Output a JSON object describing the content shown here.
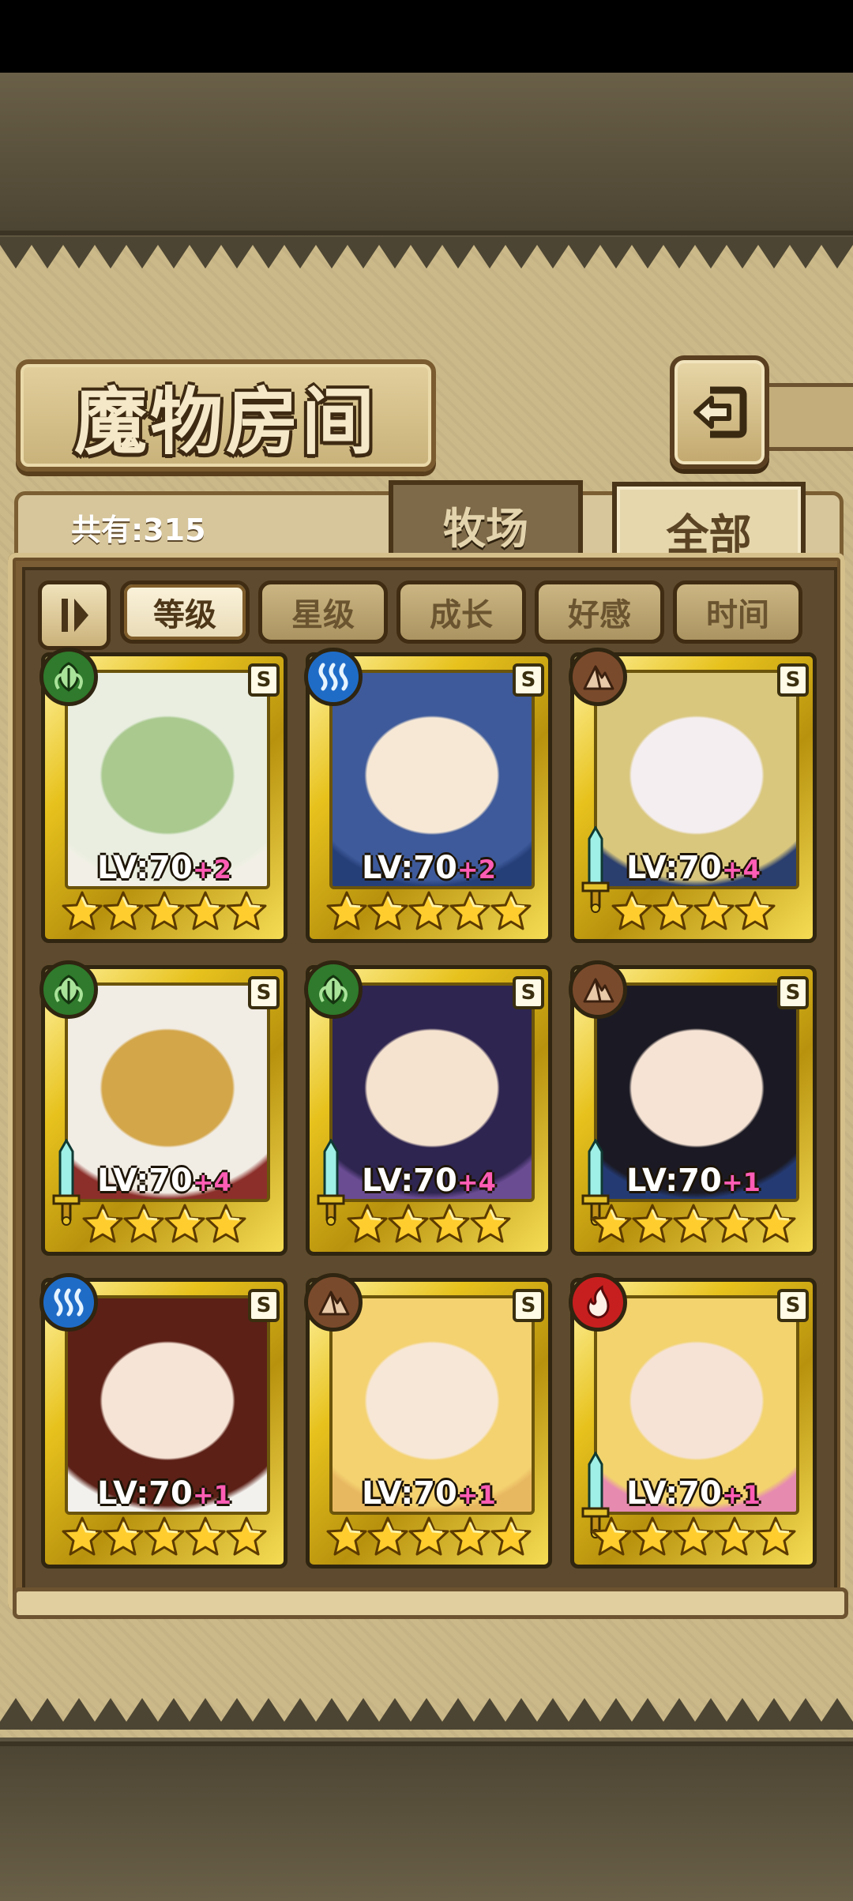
{
  "title": "魔物房间",
  "count_text": "共有:315",
  "tabs": [
    {
      "label": "牧场",
      "active": false
    },
    {
      "label": "全部",
      "active": true
    }
  ],
  "sort_filters": [
    {
      "label": "等级",
      "active": true
    },
    {
      "label": "星级",
      "active": false
    },
    {
      "label": "成长",
      "active": false
    },
    {
      "label": "好感",
      "active": false
    },
    {
      "label": "时间",
      "active": false
    }
  ],
  "cards": [
    {
      "element": "leaf",
      "rank": "S",
      "level": "LV:70",
      "plus": "+2",
      "stars": 5,
      "weapon": false,
      "palette": [
        "#e9eee0",
        "#a9c98f",
        "#f2f0e6"
      ]
    },
    {
      "element": "water",
      "rank": "S",
      "level": "LV:70",
      "plus": "+2",
      "stars": 5,
      "weapon": false,
      "palette": [
        "#3e5a9a",
        "#f6e8d5",
        "#253f79"
      ]
    },
    {
      "element": "earth",
      "rank": "S",
      "level": "LV:70",
      "plus": "+4",
      "stars": 4,
      "weapon": true,
      "palette": [
        "#d9c77e",
        "#f4eef0",
        "#2b3f6e"
      ]
    },
    {
      "element": "leaf",
      "rank": "S",
      "level": "LV:70",
      "plus": "+4",
      "stars": 4,
      "weapon": true,
      "palette": [
        "#f1ece4",
        "#d3a64a",
        "#8c2f2a"
      ]
    },
    {
      "element": "leaf",
      "rank": "S",
      "level": "LV:70",
      "plus": "+4",
      "stars": 4,
      "weapon": true,
      "palette": [
        "#2e2550",
        "#f6e3cf",
        "#6a4c93"
      ]
    },
    {
      "element": "earth",
      "rank": "S",
      "level": "LV:70",
      "plus": "+1",
      "stars": 5,
      "weapon": true,
      "palette": [
        "#1b1a24",
        "#f6e3d4",
        "#243a72"
      ]
    },
    {
      "element": "water",
      "rank": "S",
      "level": "LV:70",
      "plus": "+1",
      "stars": 5,
      "weapon": false,
      "palette": [
        "#5c2017",
        "#f6e4d6",
        "#f3f1ee"
      ]
    },
    {
      "element": "earth",
      "rank": "S",
      "level": "LV:70",
      "plus": "+1",
      "stars": 5,
      "weapon": false,
      "palette": [
        "#f4d270",
        "#f7e7d6",
        "#e8b861"
      ]
    },
    {
      "element": "fire",
      "rank": "S",
      "level": "LV:70",
      "plus": "+1",
      "stars": 5,
      "weapon": true,
      "palette": [
        "#f2d36e",
        "#f6e3d6",
        "#e68ab0"
      ]
    }
  ],
  "colors": {
    "leaf": "#2f7a2c",
    "water": "#1f6cc7",
    "earth": "#7a4a2c",
    "fire": "#c71f1f",
    "gold": "#e7c21d",
    "plus": "#ff5db5"
  }
}
